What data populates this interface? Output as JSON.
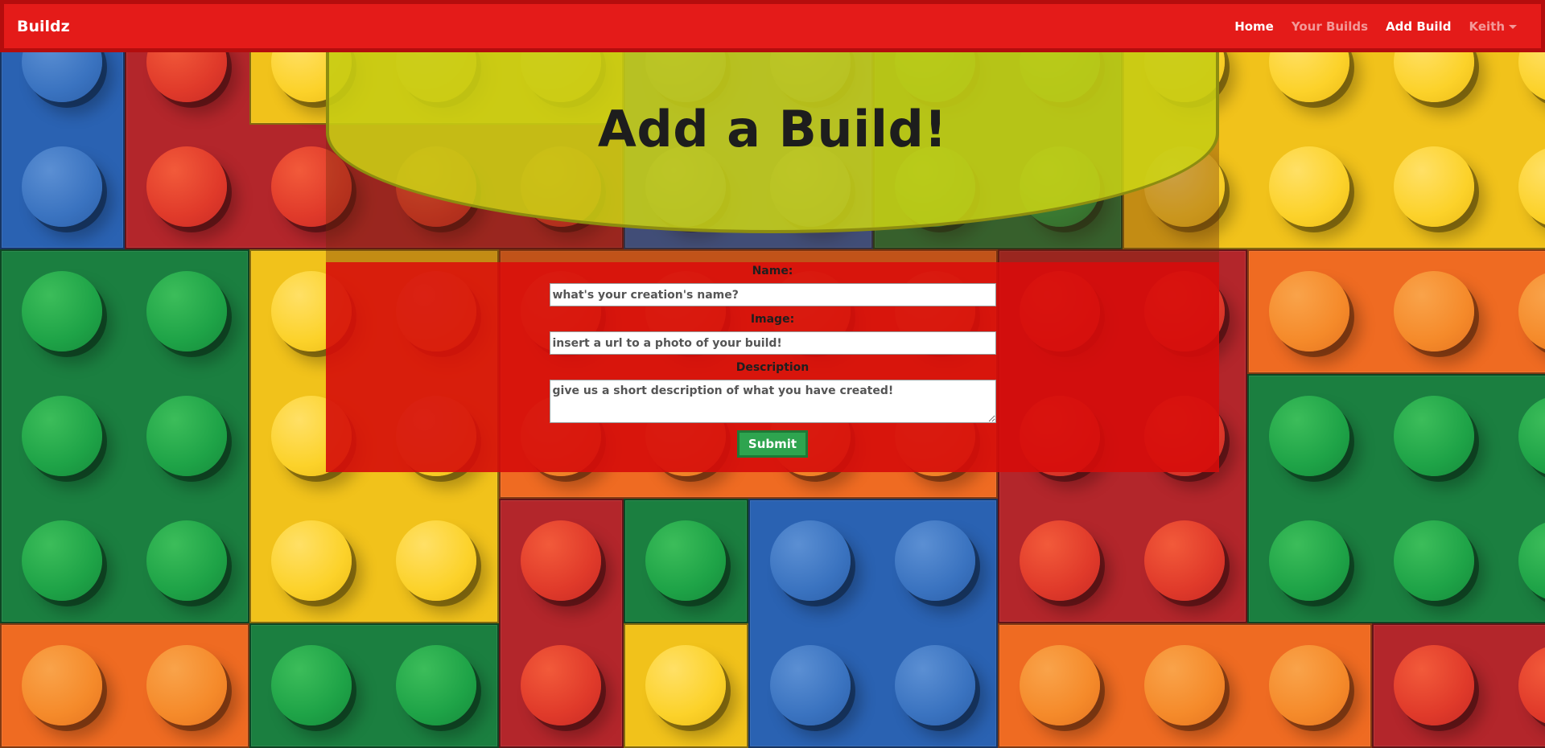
{
  "navbar": {
    "brand": "Buildz",
    "links": [
      "Home",
      "Your Builds",
      "Add Build",
      "Keith"
    ]
  },
  "page": {
    "title": "Add a Build!"
  },
  "form": {
    "name_label": "Name:",
    "name_placeholder": "what's your creation's name?",
    "image_label": "Image:",
    "image_placeholder": "insert a url to a photo of your build!",
    "description_label": "Description",
    "description_placeholder": "give us a short description of what you have created!",
    "submit_label": "Submit"
  },
  "colors": {
    "navbar": "#e41b19",
    "banner": "#cdd614",
    "form_panel": "#dc0a0a",
    "submit": "#2ea44f",
    "lego_palette": [
      "#2a62b2",
      "#b3262b",
      "#1b7f40",
      "#f1c21b",
      "#ef6b22"
    ]
  }
}
